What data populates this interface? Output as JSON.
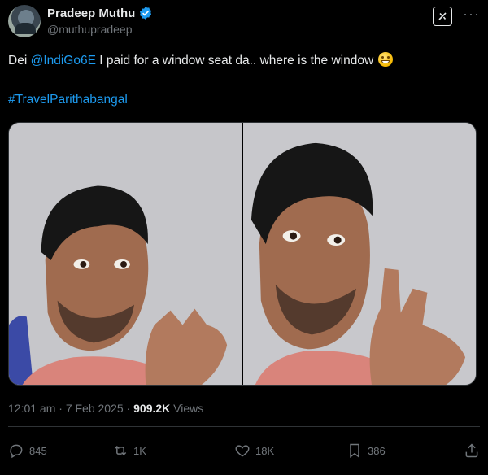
{
  "author": {
    "display_name": "Pradeep Muthu",
    "handle": "@muthupradeep",
    "verified_icon": "verified-badge-icon",
    "avatar_icon": "avatar"
  },
  "header_icons": {
    "grok": "grok-icon",
    "more": "more-options-icon"
  },
  "tweet": {
    "text_before": "Dei ",
    "mention": "@IndiGo6E",
    "text_after": " I paid for a window seat da.. where is the window ",
    "emoji_icon": "grimacing-face-emoji",
    "hashtag": "#TravelParithabangal"
  },
  "media": {
    "count": 2
  },
  "meta": {
    "time": "12:01 am",
    "sep": " · ",
    "date": "7 Feb 2025",
    "sep2": " · ",
    "views_count": "909.2K",
    "views_label": "Views"
  },
  "actions": {
    "reply_count": "845",
    "repost_count": "1K",
    "like_count": "18K",
    "bookmark_count": "386"
  },
  "colors": {
    "background": "#000000",
    "text": "#e7e9ea",
    "muted": "#71767b",
    "accent": "#1d9bf0",
    "divider": "#2f3336"
  }
}
